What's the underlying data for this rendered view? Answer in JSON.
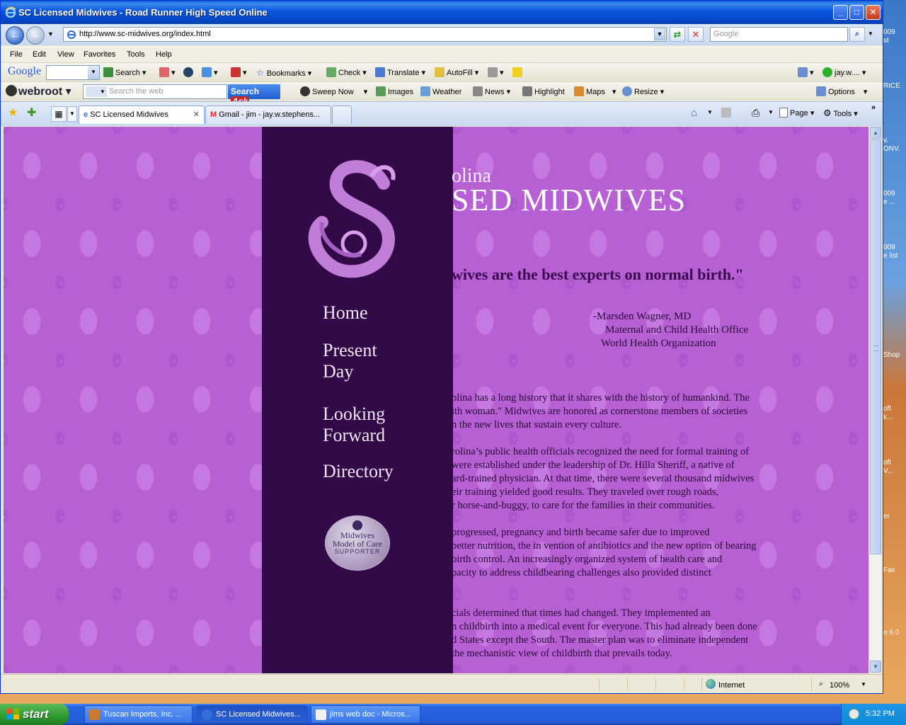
{
  "window": {
    "title": "SC Licensed Midwives - Road Runner High Speed Online",
    "controls": {
      "minimize": "_",
      "maximize": "□",
      "close": "✕"
    }
  },
  "address_bar": {
    "url": "http://www.sc-midwives.org/index.html",
    "search_placeholder": "Google"
  },
  "menu": [
    "File",
    "Edit",
    "View",
    "Favorites",
    "Tools",
    "Help"
  ],
  "google_toolbar": {
    "logo": "Google",
    "search_label": "Search",
    "bookmarks_label": "Bookmarks",
    "check_label": "Check",
    "translate_label": "Translate",
    "autofill_label": "AutoFill",
    "account_label": "jay.w...."
  },
  "webroot_toolbar": {
    "logo": "webroot",
    "search_placeholder": "Search the web",
    "search_button": "Search",
    "ask_label": "Ask",
    "sweep_label": "Sweep Now",
    "images_label": "Images",
    "weather_label": "Weather",
    "news_label": "News",
    "highlight_label": "Highlight",
    "maps_label": "Maps",
    "resize_label": "Resize",
    "options_label": "Options"
  },
  "tabs": [
    {
      "label": "SC Licensed Midwives"
    },
    {
      "label": "Gmail - jim - jay.w.stephens..."
    }
  ],
  "command_bar": {
    "page_label": "Page",
    "tools_label": "Tools"
  },
  "page": {
    "header_small": "olina",
    "header_big": "SED MIDWIVES",
    "quote": "wives are the best experts on normal birth.\"",
    "attribution": [
      "-Marsden Wagner, MD",
      "Maternal and Child Health Office",
      "World Health Organization"
    ],
    "nav": [
      {
        "line1": "Home",
        "line2": ""
      },
      {
        "line1": "Present",
        "line2": "Day"
      },
      {
        "line1": "Looking",
        "line2": "Forward"
      },
      {
        "line1": "Directory",
        "line2": ""
      }
    ],
    "badge": {
      "line1": "Midwives",
      "line2": "Model of Care",
      "line3": "SUPPORTER"
    },
    "body_lines": [
      "olina has a long history that it shares with the history of humankind. The",
      "ith woman.\" Midwives are honored as cornerstone members of societies",
      "n the new lives that sustain every culture.",
      "rolina’s public health officials recognized the need for formal training of",
      "were established under the leadership of Dr. Hilla Sheriff, a native of",
      "ard-trained physician. At that time, there were several thousand midwives",
      "eir training yielded good results. They traveled over rough roads,",
      "r horse-and-buggy, to care for the families in their communities.",
      " progressed, pregnancy and birth became safer due to improved",
      "better nutrition, the in vention of antibiotics and the new option of bearing",
      "birth control. An increasingly organized system of health care and",
      "pacity to address childbearing challenges also provided distinct",
      "cials determined that times had changed. They implemented an",
      "n childbirth into a medical event for everyone. This had already been done",
      "d States except the South. The master plan was to eliminate independent",
      "the mechanistic view of childbirth that prevails today."
    ]
  },
  "status_bar": {
    "zone": "Internet",
    "zoom": "100%"
  },
  "taskbar": {
    "start_label": "start",
    "items": [
      {
        "label": "Tuscan Imports, Inc. ..."
      },
      {
        "label": "SC Licensed Midwives..."
      },
      {
        "label": "jims web doc - Micros..."
      }
    ],
    "clock": "5:32 PM"
  },
  "desktop_fragments": [
    "009",
    "st",
    "RICE",
    "v.",
    "ONV.",
    "009",
    "e ...",
    "009",
    "e list",
    "Shop",
    "oft",
    "k...",
    "oft",
    "V...",
    "er",
    "Fax",
    "o 6.0"
  ],
  "colors": {
    "page_background": "#b660d4",
    "sidebar": "#320a47",
    "quote_text": "#3a0a4e",
    "title_bar": "#0855dd"
  }
}
